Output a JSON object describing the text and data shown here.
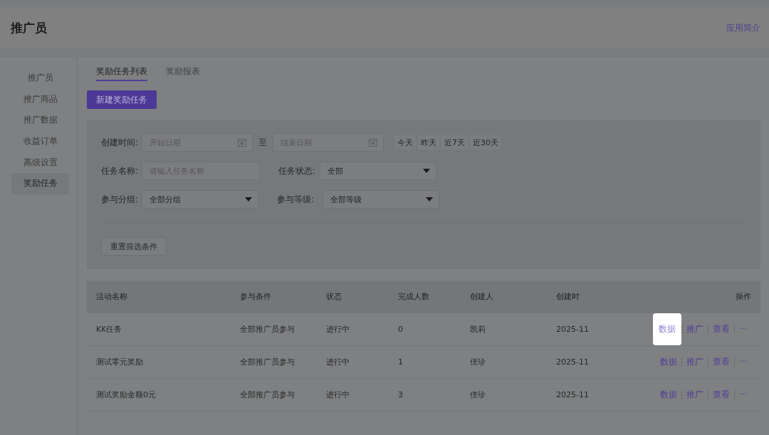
{
  "header": {
    "title": "推广员",
    "link": "应用简介"
  },
  "sidebar": {
    "items": [
      {
        "label": "推广员",
        "selected": false
      },
      {
        "label": "推广商品",
        "selected": false
      },
      {
        "label": "推广数据",
        "selected": false
      },
      {
        "label": "收益订单",
        "selected": false
      },
      {
        "label": "高级设置",
        "selected": false
      },
      {
        "label": "奖励任务",
        "selected": true
      }
    ]
  },
  "tabs": [
    {
      "label": "奖励任务列表",
      "selected": true
    },
    {
      "label": "奖励报表",
      "selected": false
    }
  ],
  "create_button": "新建奖励任务",
  "filters": {
    "date": {
      "label": "创建时间:",
      "start_placeholder": "开始日期",
      "separator": "至",
      "end_placeholder": "结束日期",
      "quick": [
        "今天",
        "昨天",
        "近7天",
        "近30天"
      ]
    },
    "name": {
      "label": "任务名称:",
      "placeholder": "请输入任务名称"
    },
    "status": {
      "label": "任务状态:",
      "value": "全部"
    },
    "group": {
      "label": "参与分组:",
      "value": "全部分组"
    },
    "level": {
      "label": "参与等级:",
      "value": "全部等级"
    },
    "reset": "重置筛选条件"
  },
  "table": {
    "columns": [
      "活动名称",
      "参与条件",
      "状态",
      "完成人数",
      "创建人",
      "创建时",
      "操作"
    ],
    "rows": [
      {
        "cells": [
          "KK任务",
          "全部推广员参与",
          "进行中",
          "0",
          "凯莉",
          "2025-11"
        ],
        "actions": [
          {
            "label": "数据",
            "highlighted": true
          },
          {
            "label": "推广",
            "highlighted": false
          },
          {
            "label": "查看",
            "highlighted": false
          },
          {
            "label": "···",
            "highlighted": false
          }
        ]
      },
      {
        "cells": [
          "测试零元奖励",
          "全部推广员参与",
          "进行中",
          "1",
          "佳珍",
          "2025-11"
        ],
        "actions": [
          {
            "label": "数据",
            "highlighted": false
          },
          {
            "label": "推广",
            "highlighted": false
          },
          {
            "label": "查看",
            "highlighted": false
          },
          {
            "label": "···",
            "highlighted": false
          }
        ]
      },
      {
        "cells": [
          "测试奖励金额0元",
          "全部推广员参与",
          "进行中",
          "3",
          "佳珍",
          "2025-11"
        ],
        "actions": [
          {
            "label": "数据",
            "highlighted": false
          },
          {
            "label": "推广",
            "highlighted": false
          },
          {
            "label": "查看",
            "highlighted": false
          },
          {
            "label": "···",
            "highlighted": false
          }
        ]
      }
    ]
  }
}
